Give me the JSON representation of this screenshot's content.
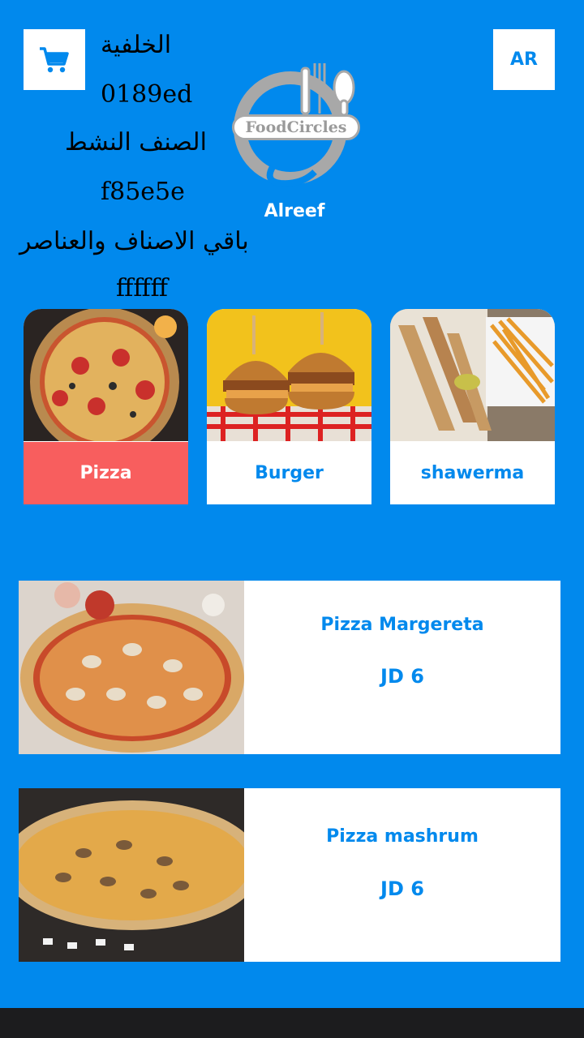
{
  "header": {
    "language_label": "AR",
    "store_name": "Alreef",
    "logo_text": "FoodCircles"
  },
  "color_info": {
    "background_label": "الخلفية",
    "background_value": "0189ed",
    "active_label": "الصنف النشط",
    "active_value": "f85e5e",
    "rest_label": "باقي الاصناف والعناصر",
    "rest_value": "ffffff"
  },
  "colors": {
    "background": "#0189ed",
    "active": "#f85e5e",
    "rest": "#ffffff"
  },
  "categories": [
    {
      "label": "Pizza",
      "active": true,
      "icon": "pizza-photo"
    },
    {
      "label": "Burger",
      "active": false,
      "icon": "burger-photo"
    },
    {
      "label": "shawerma",
      "active": false,
      "icon": "shawerma-photo"
    }
  ],
  "items": [
    {
      "name": "Pizza Margereta",
      "price": "JD 6"
    },
    {
      "name": "Pizza mashrum",
      "price": "JD 6"
    }
  ]
}
